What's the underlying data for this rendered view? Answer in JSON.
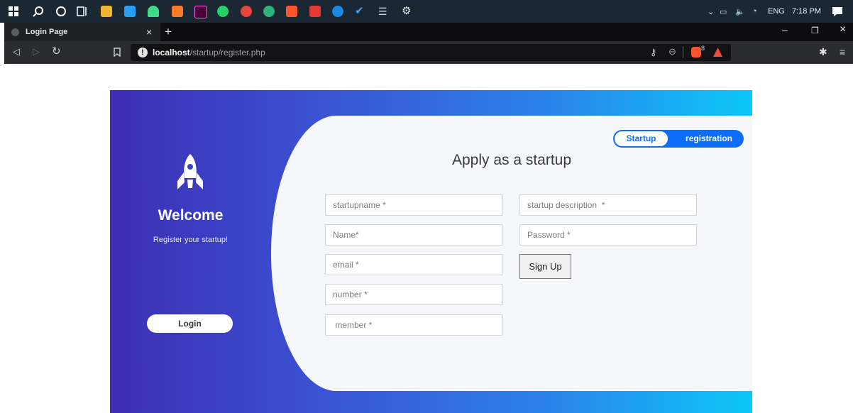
{
  "browser": {
    "tab_title": "Login Page",
    "url_host": "localhost",
    "url_path": "/startup/register.php",
    "extension_badge": "8"
  },
  "system_tray": {
    "language": "ENG",
    "time": "7:18 PM"
  },
  "sidebar": {
    "title": "Welcome",
    "subtitle": "Register your startup!",
    "login_label": "Login"
  },
  "toggle": {
    "left_label": "Startup",
    "right_label": "registration"
  },
  "form": {
    "title": "Apply as a startup",
    "fields": {
      "startupname": "startupname *",
      "description": "startup description  *",
      "name": "Name*",
      "password": "Password *",
      "email": "email *",
      "number": "number *",
      "member": " member *"
    },
    "submit_label": "Sign Up"
  },
  "colors": {
    "gradient_start": "#3d2db3",
    "gradient_end": "#0cc8f8",
    "toggle_blue": "#0d6efd",
    "panel_bg": "#f6f7fa"
  }
}
